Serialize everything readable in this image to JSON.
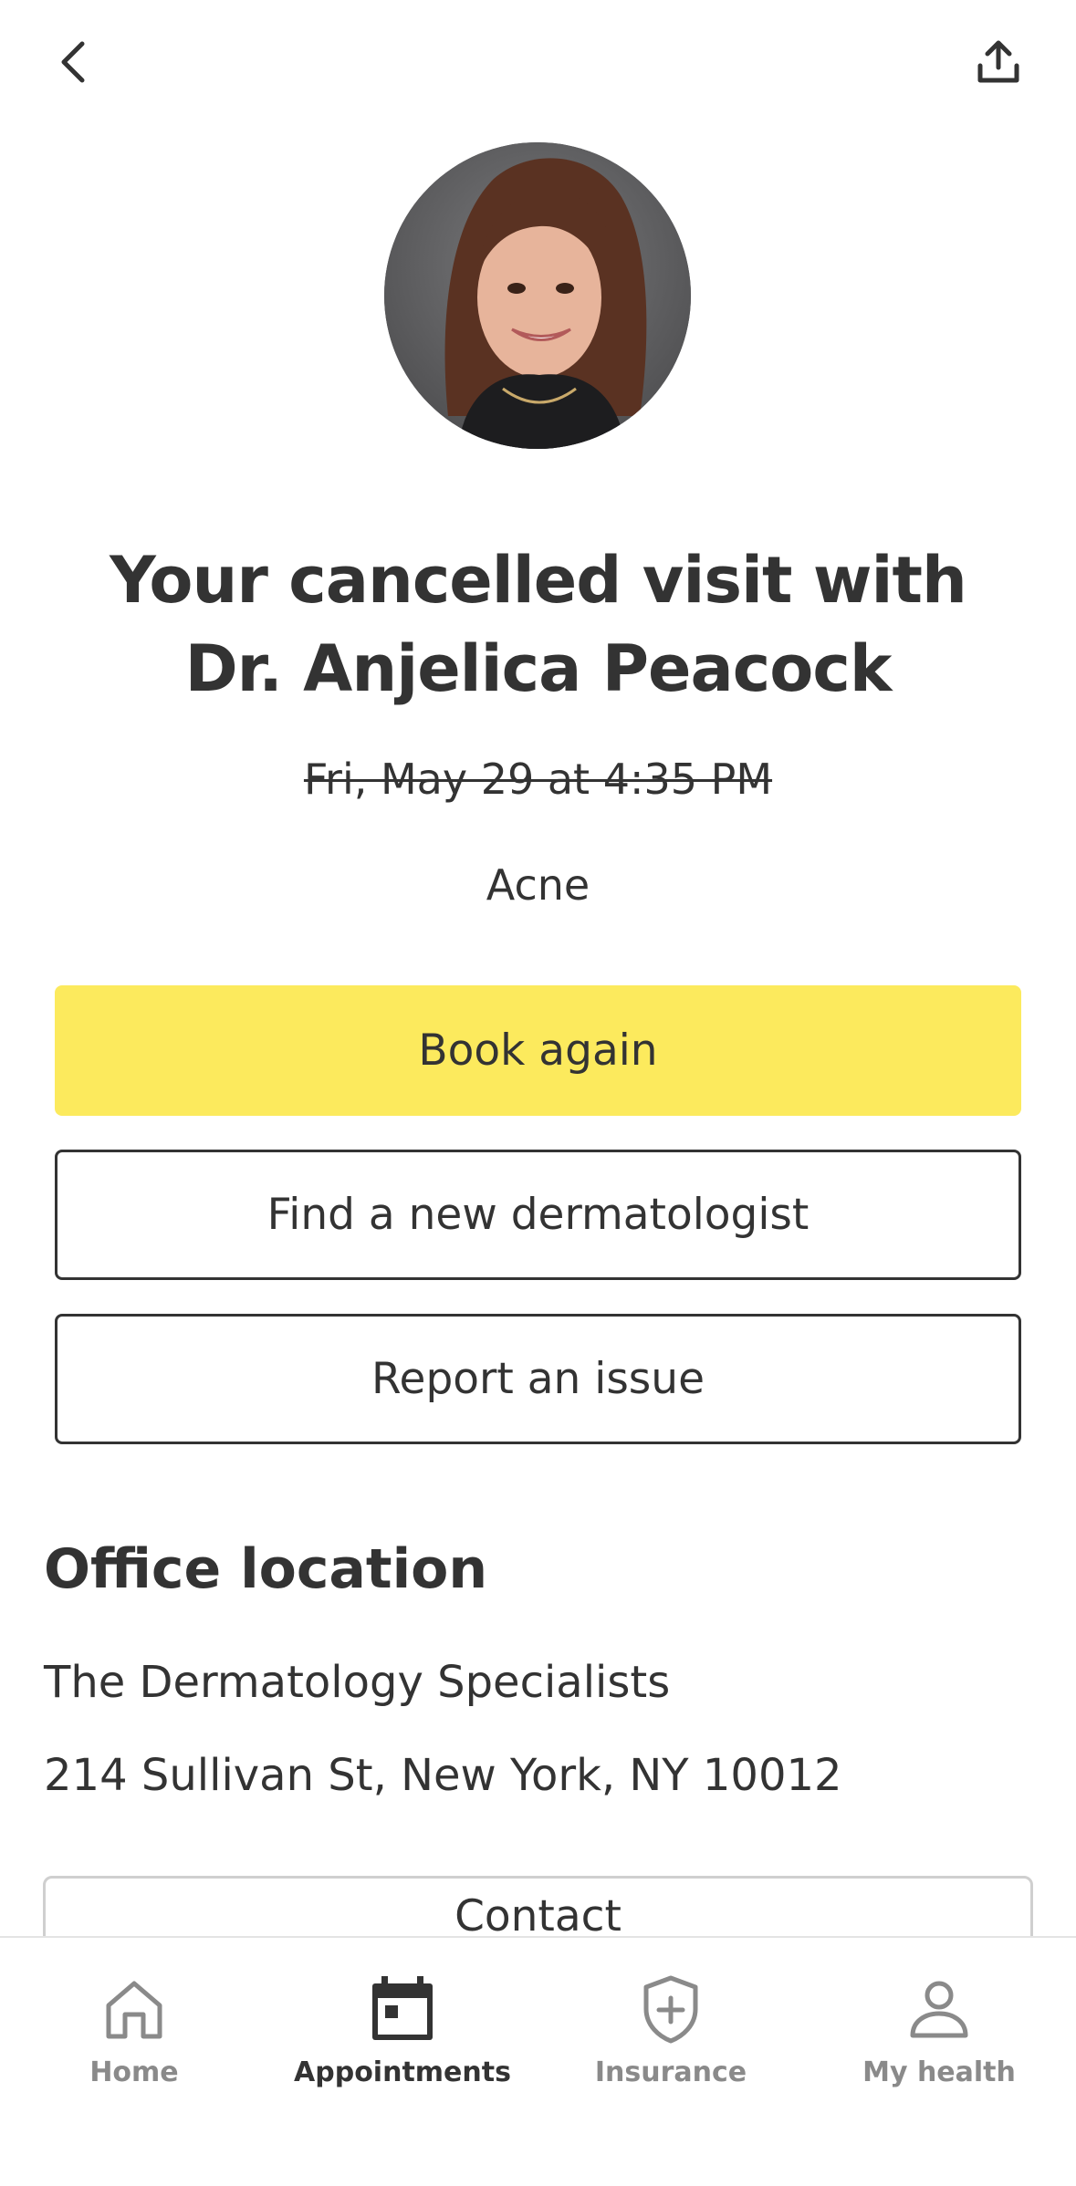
{
  "header": {
    "back_icon": "chevron-left-icon",
    "share_icon": "share-upload-icon"
  },
  "provider": {
    "title": "Your cancelled visit with Dr. Anjelica Peacock",
    "visit_date": "Fri, May 29 at 4:35 PM",
    "reason": "Acne"
  },
  "actions": {
    "book_again": "Book again",
    "find_new": "Find a new dermatologist",
    "report_issue": "Report an issue"
  },
  "office": {
    "section_title": "Office location",
    "name": "The Dermatology Specialists",
    "address": "214 Sullivan St, New York, NY 10012",
    "contact_label": "Contact"
  },
  "tab_bar": {
    "active": "Appointments",
    "items": [
      {
        "label": "Home",
        "icon": "home-icon"
      },
      {
        "label": "Appointments",
        "icon": "calendar-icon"
      },
      {
        "label": "Insurance",
        "icon": "shield-plus-icon"
      },
      {
        "label": "My health",
        "icon": "person-icon"
      }
    ]
  },
  "colors": {
    "accent_yellow": "#fcea5d",
    "text_dark": "#333333",
    "tab_inactive": "#8a8a8a"
  }
}
